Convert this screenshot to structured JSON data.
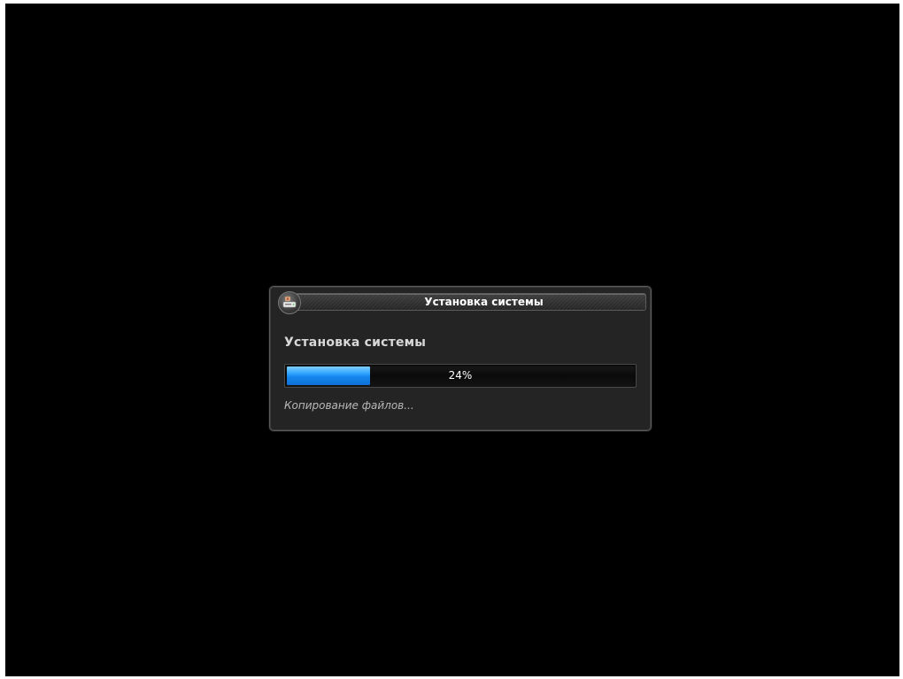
{
  "dialog": {
    "window_title": "Установка системы",
    "heading": "Установка системы",
    "progress": {
      "percent": 24,
      "label": "24%"
    },
    "status_text": "Копирование файлов...",
    "icon": "installer-drive-icon"
  },
  "colors": {
    "background": "#000000",
    "dialog": "#242424",
    "progress_fill": "#1487f0"
  }
}
